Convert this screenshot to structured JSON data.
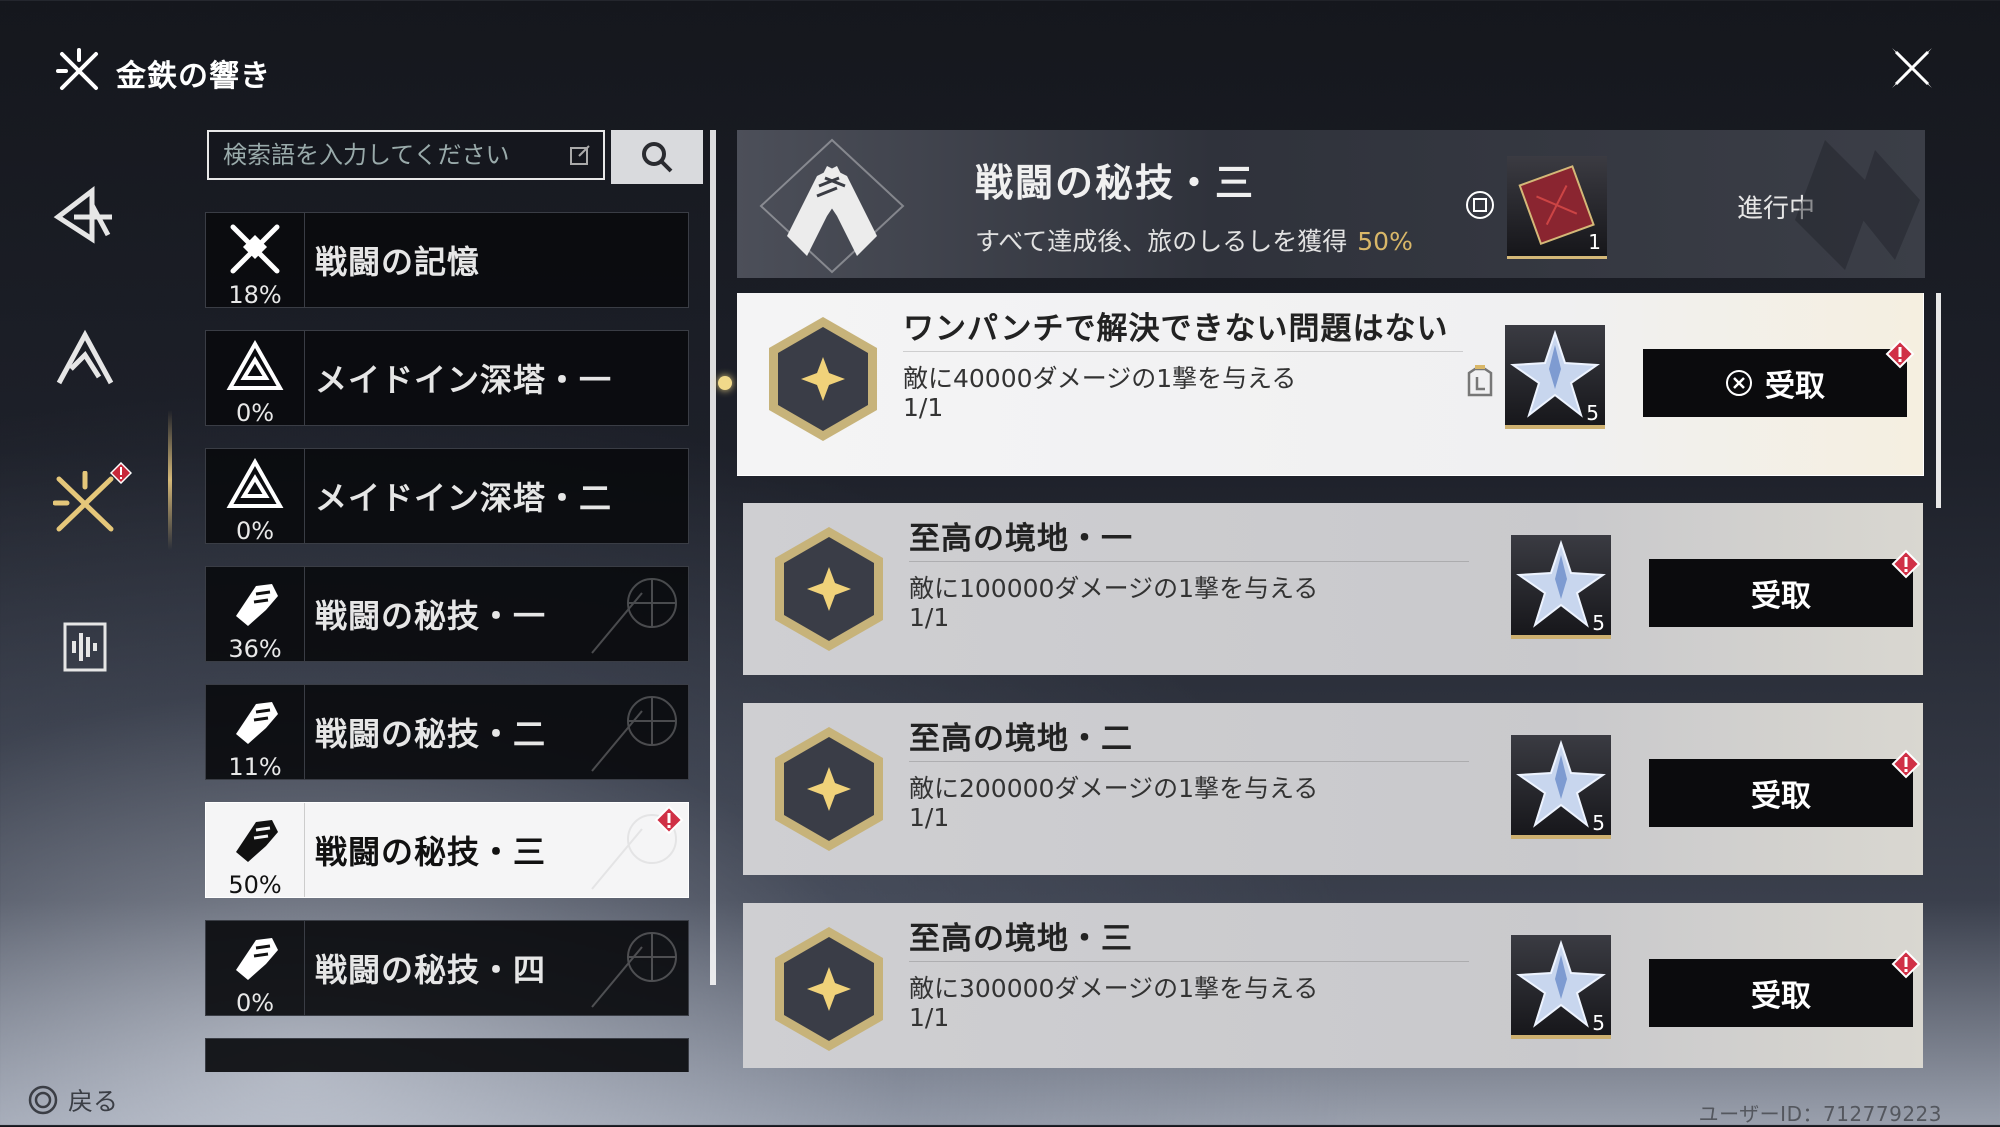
{
  "window": {
    "title": "金鉄の響き"
  },
  "search": {
    "placeholder": "検索語を入力してください"
  },
  "categories": [
    {
      "name": "戦闘の記憶",
      "percent": "18%"
    },
    {
      "name": "メイドイン深塔・一",
      "percent": "0%"
    },
    {
      "name": "メイドイン深塔・二",
      "percent": "0%"
    },
    {
      "name": "戦闘の秘技・一",
      "percent": "36%"
    },
    {
      "name": "戦闘の秘技・二",
      "percent": "11%"
    },
    {
      "name": "戦闘の秘技・三",
      "percent": "50%",
      "selected": true
    },
    {
      "name": "戦闘の秘技・四",
      "percent": "0%"
    }
  ],
  "header": {
    "name": "戦闘の秘技・三",
    "description": "すべて達成後、旅のしるしを獲得",
    "percent": "50%",
    "reward_count": "1",
    "status": "進行中"
  },
  "tasks": [
    {
      "name": "ワンパンチで解決できない問題はない",
      "description": "敵に40000ダメージの1撃を与える",
      "progress": "1/1",
      "reward_count": "5",
      "claim_label": "受取"
    },
    {
      "name": "至高の境地・一",
      "description": "敵に100000ダメージの1撃を与える",
      "progress": "1/1",
      "reward_count": "5",
      "claim_label": "受取"
    },
    {
      "name": "至高の境地・二",
      "description": "敵に200000ダメージの1撃を与える",
      "progress": "1/1",
      "reward_count": "5",
      "claim_label": "受取"
    },
    {
      "name": "至高の境地・三",
      "description": "敵に300000ダメージの1撃を与える",
      "progress": "1/1",
      "reward_count": "5",
      "claim_label": "受取"
    }
  ],
  "footer": {
    "back_label": "戻る",
    "user_id": "ユーザーID：712779223"
  },
  "colors": {
    "accent_gold": "#d9b768",
    "alert_red": "#c8283a"
  }
}
